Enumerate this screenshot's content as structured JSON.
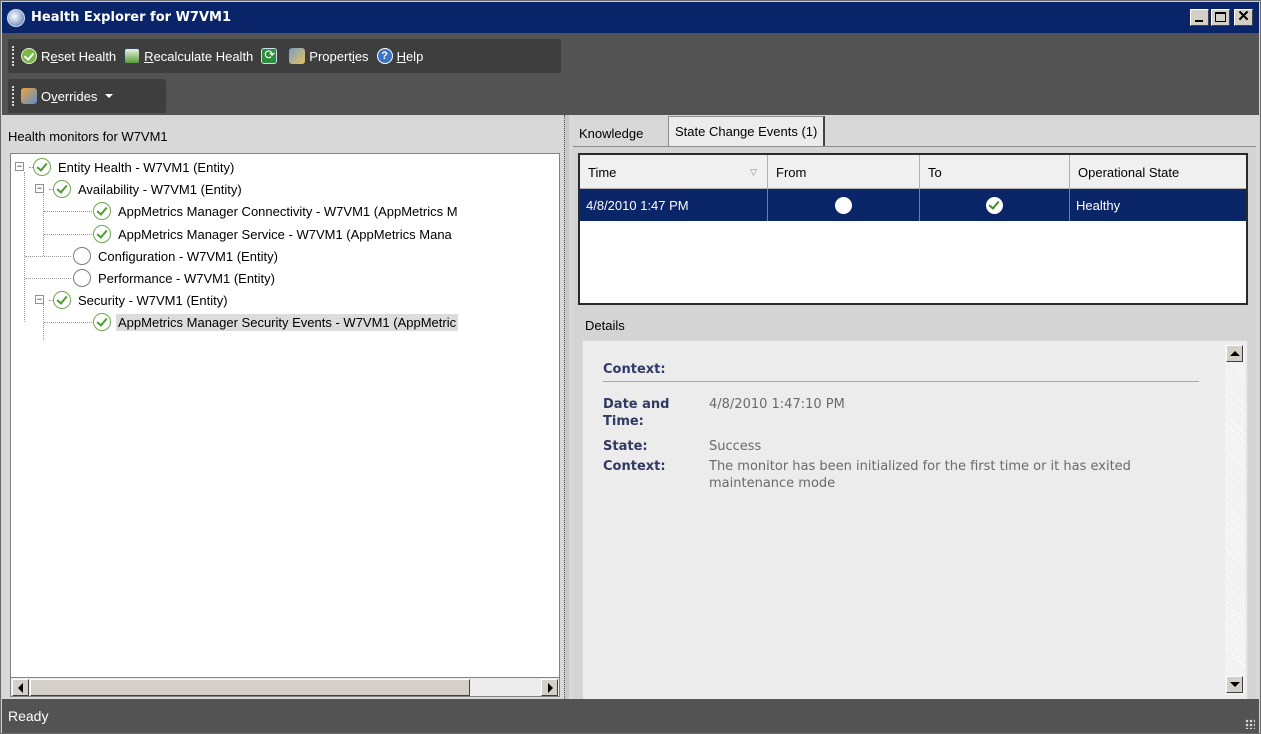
{
  "window": {
    "title": "Health Explorer for W7VM1",
    "controls": {
      "minimize": "_",
      "maximize": "□",
      "close": "✕"
    }
  },
  "toolbar": {
    "buttons": [
      {
        "pre": "R",
        "ul": "e",
        "post": "set Health",
        "icon": "check-icon"
      },
      {
        "pre": "",
        "ul": "R",
        "post": "ecalculate Health",
        "icon": "chart-icon"
      },
      {
        "pre": "",
        "ul": "",
        "post": "",
        "icon": "refresh-icon"
      },
      {
        "pre": "Propert",
        "ul": "i",
        "post": "es",
        "icon": "properties-icon"
      },
      {
        "pre": "",
        "ul": "H",
        "post": "elp",
        "icon": "help-icon"
      }
    ],
    "overrides": {
      "pre": "O",
      "ul": "v",
      "post": "errides"
    }
  },
  "left": {
    "header": "Health monitors for W7VM1",
    "tree": [
      {
        "label": "Entity Health - W7VM1 (Entity)",
        "state": "healthy",
        "expander": "−"
      },
      {
        "label": "Availability - W7VM1 (Entity)",
        "state": "healthy",
        "expander": "−"
      },
      {
        "label": "AppMetrics Manager Connectivity - W7VM1 (AppMetrics M",
        "state": "healthy",
        "expander": ""
      },
      {
        "label": "AppMetrics Manager Service - W7VM1 (AppMetrics Mana",
        "state": "healthy",
        "expander": ""
      },
      {
        "label": "Configuration - W7VM1 (Entity)",
        "state": "empty",
        "expander": ""
      },
      {
        "label": "Performance - W7VM1 (Entity)",
        "state": "empty",
        "expander": ""
      },
      {
        "label": "Security - W7VM1 (Entity)",
        "state": "healthy",
        "expander": "−"
      },
      {
        "label": "AppMetrics Manager Security Events - W7VM1 (AppMetric",
        "state": "healthy",
        "expander": "",
        "selected": true
      }
    ]
  },
  "right": {
    "tabs": [
      {
        "label": "Knowledge",
        "active": false
      },
      {
        "label": "State Change Events (1)",
        "active": true
      }
    ],
    "grid": {
      "columns": [
        "Time",
        "From",
        "To",
        "Operational State"
      ],
      "rows": [
        {
          "time": "4/8/2010 1:47 PM",
          "from": "empty-state-icon",
          "to": "healthy-check-icon",
          "operational_state": "Healthy",
          "selected": true
        }
      ]
    },
    "details": {
      "label": "Details",
      "context_title": "Context:",
      "fields": [
        {
          "key": "Date and Time:",
          "value": "4/8/2010 1:47:10 PM"
        },
        {
          "key": "State:",
          "value": "Success"
        },
        {
          "key": "Context:",
          "value": "The monitor has been initialized for the first time or it has exited maintenance mode"
        }
      ]
    }
  },
  "status": {
    "text": "Ready"
  },
  "colors": {
    "titlebar": "#0a246a",
    "toolbar_bg": "#535353",
    "selection": "#0a2568",
    "healthy": "#4e9a2d"
  }
}
